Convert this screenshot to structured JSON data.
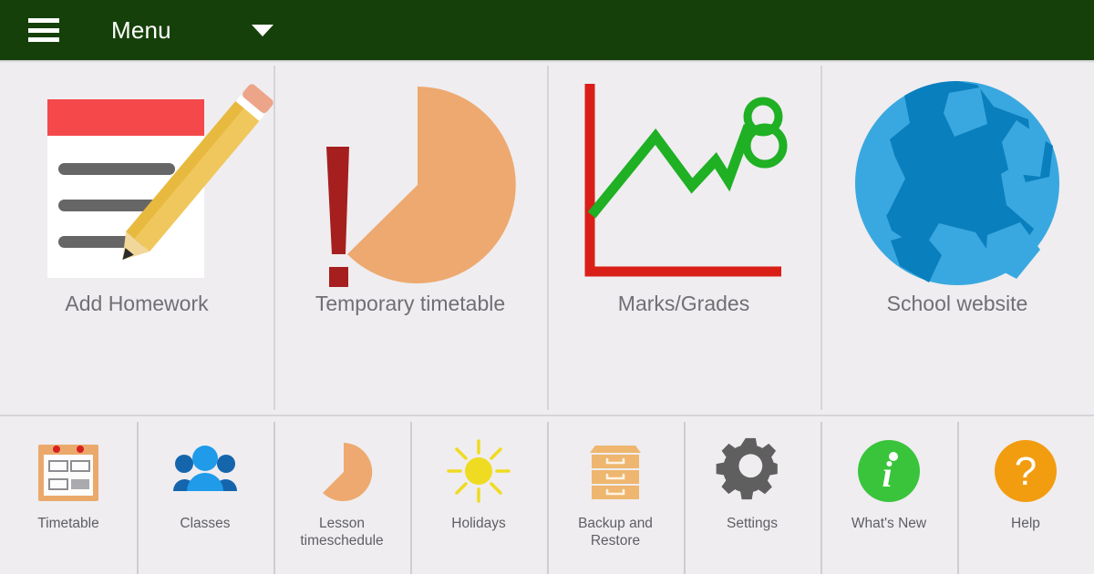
{
  "header": {
    "menu_label": "Menu",
    "hamburger_icon": "hamburger-menu-icon",
    "caret_icon": "chevron-down-icon",
    "background_color": "#16400a",
    "text_color": "#ffffff"
  },
  "main": {
    "tiles": [
      {
        "label": "Add Homework",
        "icon": "note-with-pencil-icon"
      },
      {
        "label": "Temporary timetable",
        "icon": "pie-with-exclamation-icon"
      },
      {
        "label": "Marks/Grades",
        "icon": "line-chart-grade-eight-icon"
      },
      {
        "label": "School website",
        "icon": "globe-icon"
      }
    ]
  },
  "bottom_bar": {
    "items": [
      {
        "label": "Timetable",
        "icon": "calendar-grid-icon"
      },
      {
        "label": "Classes",
        "icon": "people-group-icon"
      },
      {
        "label": "Lesson timeschedule",
        "icon": "pie-slice-icon"
      },
      {
        "label": "Holidays",
        "icon": "sun-icon"
      },
      {
        "label": "Backup and Restore",
        "icon": "file-cabinet-icon"
      },
      {
        "label": "Settings",
        "icon": "gear-icon"
      },
      {
        "label": "What's New",
        "icon": "info-circle-icon"
      },
      {
        "label": "Help",
        "icon": "question-circle-icon"
      }
    ]
  },
  "colors": {
    "background": "#efedf0",
    "divider": "#d6d4d8",
    "label_text": "#6f6f74",
    "header_green": "#16400a",
    "note_red": "#f4484a",
    "pencil_yellow": "#efc352",
    "peach": "#eda96f",
    "dark_red": "#a51f1f",
    "chart_red": "#d91f17",
    "chart_green": "#1fb024",
    "globe_land": "#0a7fbd",
    "globe_ocean": "#3aa8e0",
    "calendar_orange": "#eaa96b",
    "people_blue": "#1f9bea",
    "sun_yellow": "#efdb21",
    "cabinet_orange": "#eeb66f",
    "gear_gray": "#5f5f5f",
    "info_green": "#3ac43c",
    "help_orange": "#f29c10"
  },
  "chart_data": {
    "type": "line",
    "title": "Marks/Grades",
    "x": [
      0,
      1,
      2,
      3,
      4,
      5,
      6
    ],
    "values": [
      1,
      5.2,
      2.6,
      4.2,
      3.1,
      5.6,
      7
    ],
    "annotation": "8",
    "axis_color": "#d91f17",
    "line_color": "#1fb024",
    "grid": false
  }
}
